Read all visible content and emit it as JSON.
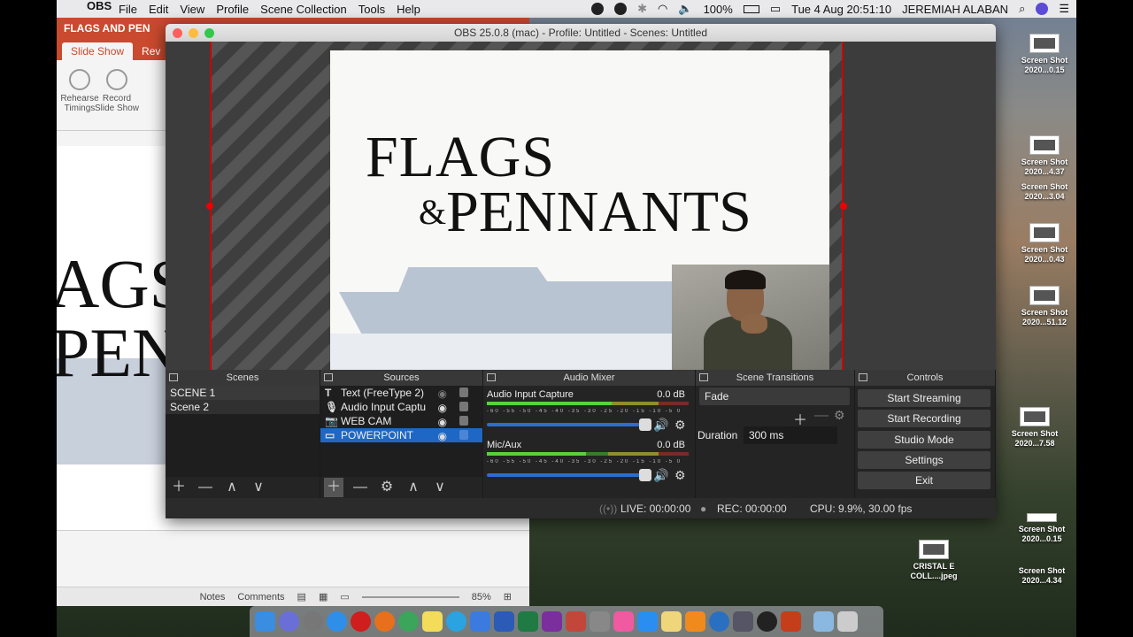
{
  "menubar": {
    "app_name": "OBS",
    "items": [
      "File",
      "Edit",
      "View",
      "Profile",
      "Scene Collection",
      "Tools",
      "Help"
    ],
    "battery": "100%",
    "datetime": "Tue 4 Aug  20:51:10",
    "user": "JEREMIAH ALABAN"
  },
  "desktop": {
    "icons": [
      {
        "label": "Screen Shot 2020...0.15"
      },
      {
        "label": "Screen Shot 2020...4.37"
      },
      {
        "label": "Screen Shot 2020...3.04"
      },
      {
        "label": "Screen Shot 2020...0.43"
      },
      {
        "label": "Screen Shot 2020...51.12"
      },
      {
        "label": "Screen Shot 2020...7.58"
      },
      {
        "label": "CRISTAL E COLL....jpeg"
      },
      {
        "label": "Screen Shot 2020...0.15"
      },
      {
        "label": "Screen Shot 2020...4.34"
      }
    ]
  },
  "powerpoint": {
    "title": "FLAGS AND PEN",
    "tabs": [
      "Slide Show",
      "Rev"
    ],
    "ribbon": {
      "rehearse": "Rehearse Timings",
      "record": "Record Slide Show"
    },
    "slide_text": {
      "line1": "AGS",
      "line2": "PEN"
    },
    "status": {
      "notes": "Notes",
      "comments": "Comments",
      "zoom": "85%"
    }
  },
  "obs": {
    "title": "OBS 25.0.8 (mac) - Profile: Untitled - Scenes: Untitled",
    "preview": {
      "line1": "FLAGS",
      "amp": "&",
      "line2": "PENNANTS"
    },
    "docks": {
      "scenes": {
        "title": "Scenes",
        "items": [
          "SCENE 1",
          "Scene 2"
        ]
      },
      "sources": {
        "title": "Sources",
        "items": [
          {
            "icon": "T",
            "label": "Text (FreeType 2)"
          },
          {
            "icon": "🎙",
            "label": "Audio Input Captu"
          },
          {
            "icon": "📷",
            "label": "WEB CAM"
          },
          {
            "icon": "▭",
            "label": "POWERPOINT"
          }
        ]
      },
      "mixer": {
        "title": "Audio Mixer",
        "channels": [
          {
            "name": "Audio Input Capture",
            "db": "0.0 dB",
            "level": 0.62
          },
          {
            "name": "Mic/Aux",
            "db": "0.0 dB",
            "level": 0.49
          }
        ],
        "scale": "-60 -55 -50 -45 -40 -35 -30 -25 -20 -15 -10 -5 0"
      },
      "transitions": {
        "title": "Scene Transitions",
        "selected": "Fade",
        "duration_label": "Duration",
        "duration": "300 ms"
      },
      "controls": {
        "title": "Controls",
        "buttons": [
          "Start Streaming",
          "Start Recording",
          "Studio Mode",
          "Settings",
          "Exit"
        ]
      }
    },
    "status": {
      "live": "LIVE: 00:00:00",
      "rec": "REC: 00:00:00",
      "cpu": "CPU: 9.9%, 30.00 fps"
    }
  }
}
